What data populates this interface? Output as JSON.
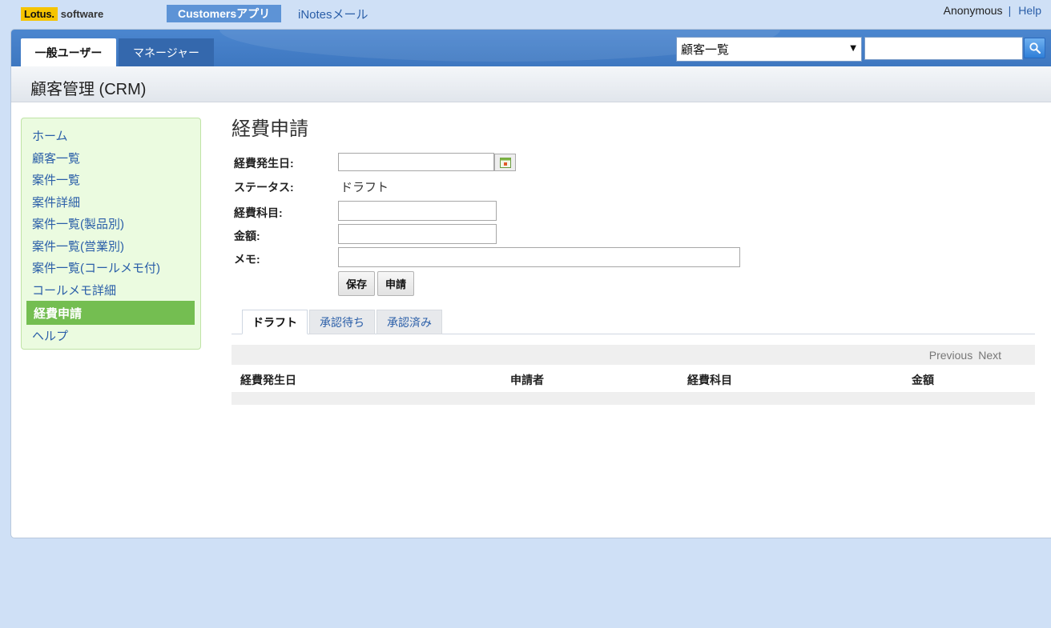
{
  "header": {
    "logo_brand": "Lotus.",
    "logo_suffix": "software",
    "app_tabs": [
      {
        "label": "Customersアプリ",
        "active": true
      },
      {
        "label": "iNotesメール",
        "active": false
      }
    ],
    "user": "Anonymous",
    "separator": "|",
    "help": "Help"
  },
  "nav": {
    "role_tabs": [
      {
        "label": "一般ユーザー",
        "active": true
      },
      {
        "label": "マネージャー",
        "active": false
      }
    ],
    "view_select": {
      "value": "顧客一覧"
    },
    "search": {
      "value": "",
      "placeholder": ""
    },
    "search_icon": "magnifier-icon"
  },
  "app_title": "顧客管理 (CRM)",
  "sidebar": {
    "items": [
      {
        "label": "ホーム",
        "active": false
      },
      {
        "label": "顧客一覧",
        "active": false
      },
      {
        "label": "案件一覧",
        "active": false
      },
      {
        "label": "案件詳細",
        "active": false
      },
      {
        "label": "案件一覧(製品別)",
        "active": false
      },
      {
        "label": "案件一覧(営業別)",
        "active": false
      },
      {
        "label": "案件一覧(コールメモ付)",
        "active": false
      },
      {
        "label": "コールメモ詳細",
        "active": false
      },
      {
        "label": "経費申請",
        "active": true
      },
      {
        "label": "ヘルプ",
        "active": false
      }
    ]
  },
  "form": {
    "heading": "経費申請",
    "date_label": "経費発生日:",
    "date_value": "",
    "calendar_icon": "calendar-icon",
    "status_label": "ステータス:",
    "status_value": "ドラフト",
    "category_label": "経費科目:",
    "category_value": "",
    "amount_label": "金額:",
    "amount_value": "",
    "memo_label": "メモ:",
    "memo_value": "",
    "save_label": "保存",
    "submit_label": "申請"
  },
  "list": {
    "tabs": [
      {
        "label": "ドラフト",
        "active": true
      },
      {
        "label": "承認待ち",
        "active": false
      },
      {
        "label": "承認済み",
        "active": false
      }
    ],
    "pager": {
      "previous": "Previous",
      "next": "Next"
    },
    "columns": [
      "経費発生日",
      "申請者",
      "経費科目",
      "金額"
    ],
    "rows": []
  },
  "colors": {
    "page_bg": "#cfe0f6",
    "nav_blue": "#4b86cf",
    "sidebar_bg": "#ebfbe0",
    "sidebar_active": "#74be51",
    "link": "#2a5ea8"
  }
}
